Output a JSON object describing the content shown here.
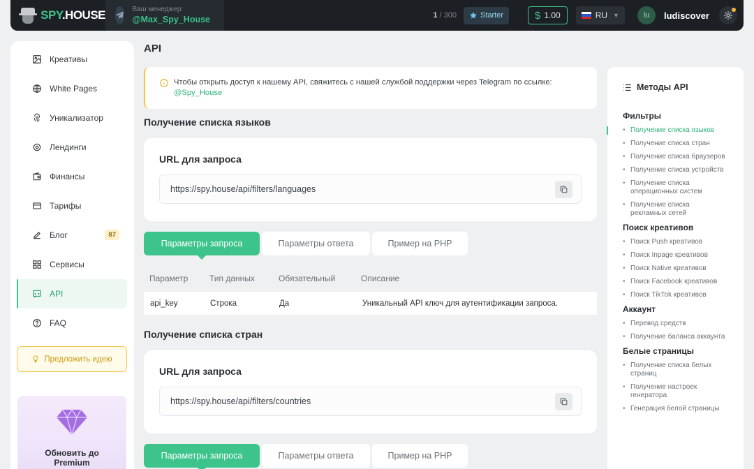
{
  "header": {
    "logo_prefix": "SPY",
    "logo_suffix": ".HOUSE",
    "manager_label": "Ваш менеджер:",
    "manager_name": "@Max_Spy_House",
    "counter_used": "1",
    "counter_total": "/ 300",
    "plan": "Starter",
    "balance_currency": "$",
    "balance": "1.00",
    "language": "RU",
    "avatar_initials": "lu",
    "username": "ludiscover",
    "colors": {
      "accent": "#3dc48b",
      "bg": "#1c2025"
    }
  },
  "sidebar": {
    "items": [
      {
        "label": "Креативы",
        "icon": "image-icon"
      },
      {
        "label": "White Pages",
        "icon": "globe-icon"
      },
      {
        "label": "Уникализатор",
        "icon": "fingerprint-icon"
      },
      {
        "label": "Лендинги",
        "icon": "target-icon"
      },
      {
        "label": "Финансы",
        "icon": "wallet-icon"
      },
      {
        "label": "Тарифы",
        "icon": "card-icon"
      },
      {
        "label": "Блог",
        "icon": "pen-icon",
        "badge": "87"
      },
      {
        "label": "Сервисы",
        "icon": "grid-icon"
      },
      {
        "label": "API",
        "icon": "api-icon",
        "active": true
      },
      {
        "label": "FAQ",
        "icon": "question-icon"
      }
    ],
    "idea_button": "Предложить идею",
    "premium_line1": "Обновить до",
    "premium_line2": "Premium"
  },
  "main": {
    "title": "API",
    "alert_text": "Чтобы открыть доступ к нашему API, свяжитесь с нашей службой поддержки через Telegram по ссылке:",
    "alert_link": "@Spy_House",
    "section1": {
      "title": "Получение списка языков",
      "url_title": "URL для запроса",
      "url": "https://spy.house/api/filters/languages"
    },
    "tabs": [
      "Параметры запроса",
      "Параметры ответа",
      "Пример на PHP"
    ],
    "table": {
      "headers": [
        "Параметр",
        "Тип данных",
        "Обязательный",
        "Описание"
      ],
      "row": [
        "api_key",
        "Строка",
        "Да",
        "Уникальный API ключ для аутентификации запроса."
      ]
    },
    "section2": {
      "title": "Получение списка стран",
      "url_title": "URL для запроса",
      "url": "https://spy.house/api/filters/countries"
    }
  },
  "methods": {
    "title": "Методы API",
    "groups": [
      {
        "name": "Фильтры",
        "links": [
          "Получение списка языков",
          "Получение списка стран",
          "Получение списка браузеров",
          "Получение списка устройств",
          "Получение списка операционных систем",
          "Получение списка рекламных сетей"
        ]
      },
      {
        "name": "Поиск креативов",
        "links": [
          "Поиск Push креативов",
          "Поиск Inpage креативов",
          "Поиск Native креативов",
          "Поиск Facebook креативов",
          "Поиск TikTok креативов"
        ]
      },
      {
        "name": "Аккаунт",
        "links": [
          "Перевод средств",
          "Получение баланса аккаунта"
        ]
      },
      {
        "name": "Белые страницы",
        "links": [
          "Получение списка белых страниц",
          "Получение настроек генератора",
          "Генерация белой страницы"
        ]
      }
    ]
  }
}
